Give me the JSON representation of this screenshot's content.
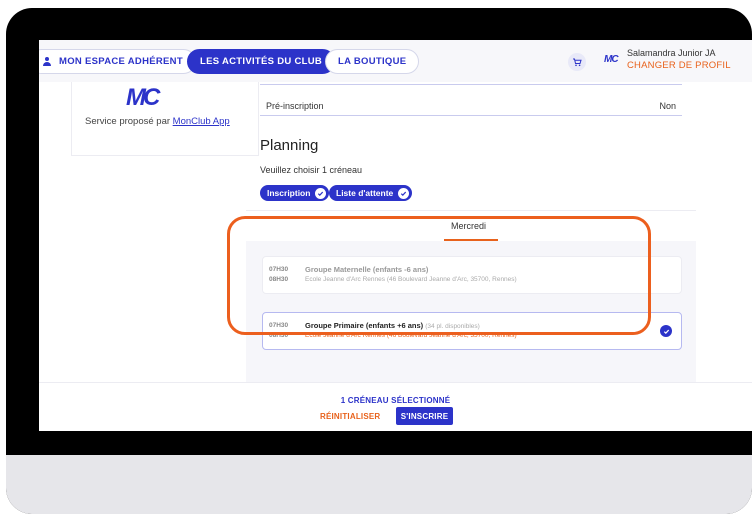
{
  "nav": {
    "espace": "MON ESPACE ADHÉRENT",
    "activites": "LES ACTIVITÉS DU CLUB",
    "boutique": "LA BOUTIQUE"
  },
  "user": {
    "logo": "MC",
    "name": "Salamandra Junior JA",
    "change_profile": "CHANGER DE PROFIL"
  },
  "club_card": {
    "logo": "MC",
    "service_text": "Service proposé par ",
    "service_link": "MonClub App"
  },
  "details": {
    "pre_label": "Pré-inscription",
    "pre_value": "Non"
  },
  "planning": {
    "title": "Planning",
    "instruction": "Veuillez choisir 1 créneau",
    "chips": [
      "Inscription",
      "Liste d'attente"
    ],
    "tab": "Mercredi"
  },
  "slots": [
    {
      "start": "07H30",
      "end": "08H30",
      "title": "Groupe Maternelle (enfants -6 ans)",
      "availability": "",
      "address": "Ecole Jeanne d'Arc Rennes (46 Boulevard Jeanne d'Arc, 35700, Rennes)",
      "selected": false
    },
    {
      "start": "07H30",
      "end": "08H30",
      "title": "Groupe Primaire (enfants +6 ans)",
      "availability": "(34 pl. disponibles)",
      "address": "Ecole Jeanne d'Arc Rennes (46 Boulevard Jeanne d'Arc, 35700, Rennes)",
      "selected": true
    }
  ],
  "footer": {
    "count": "1 CRÉNEAU SÉLECTIONNÉ",
    "reset": "RÉINITIALISER",
    "subscribe": "S'INSCRIRE"
  },
  "colors": {
    "primary": "#2c33c9",
    "accent": "#e8621c",
    "highlight_ring": "#ec5f1e"
  }
}
